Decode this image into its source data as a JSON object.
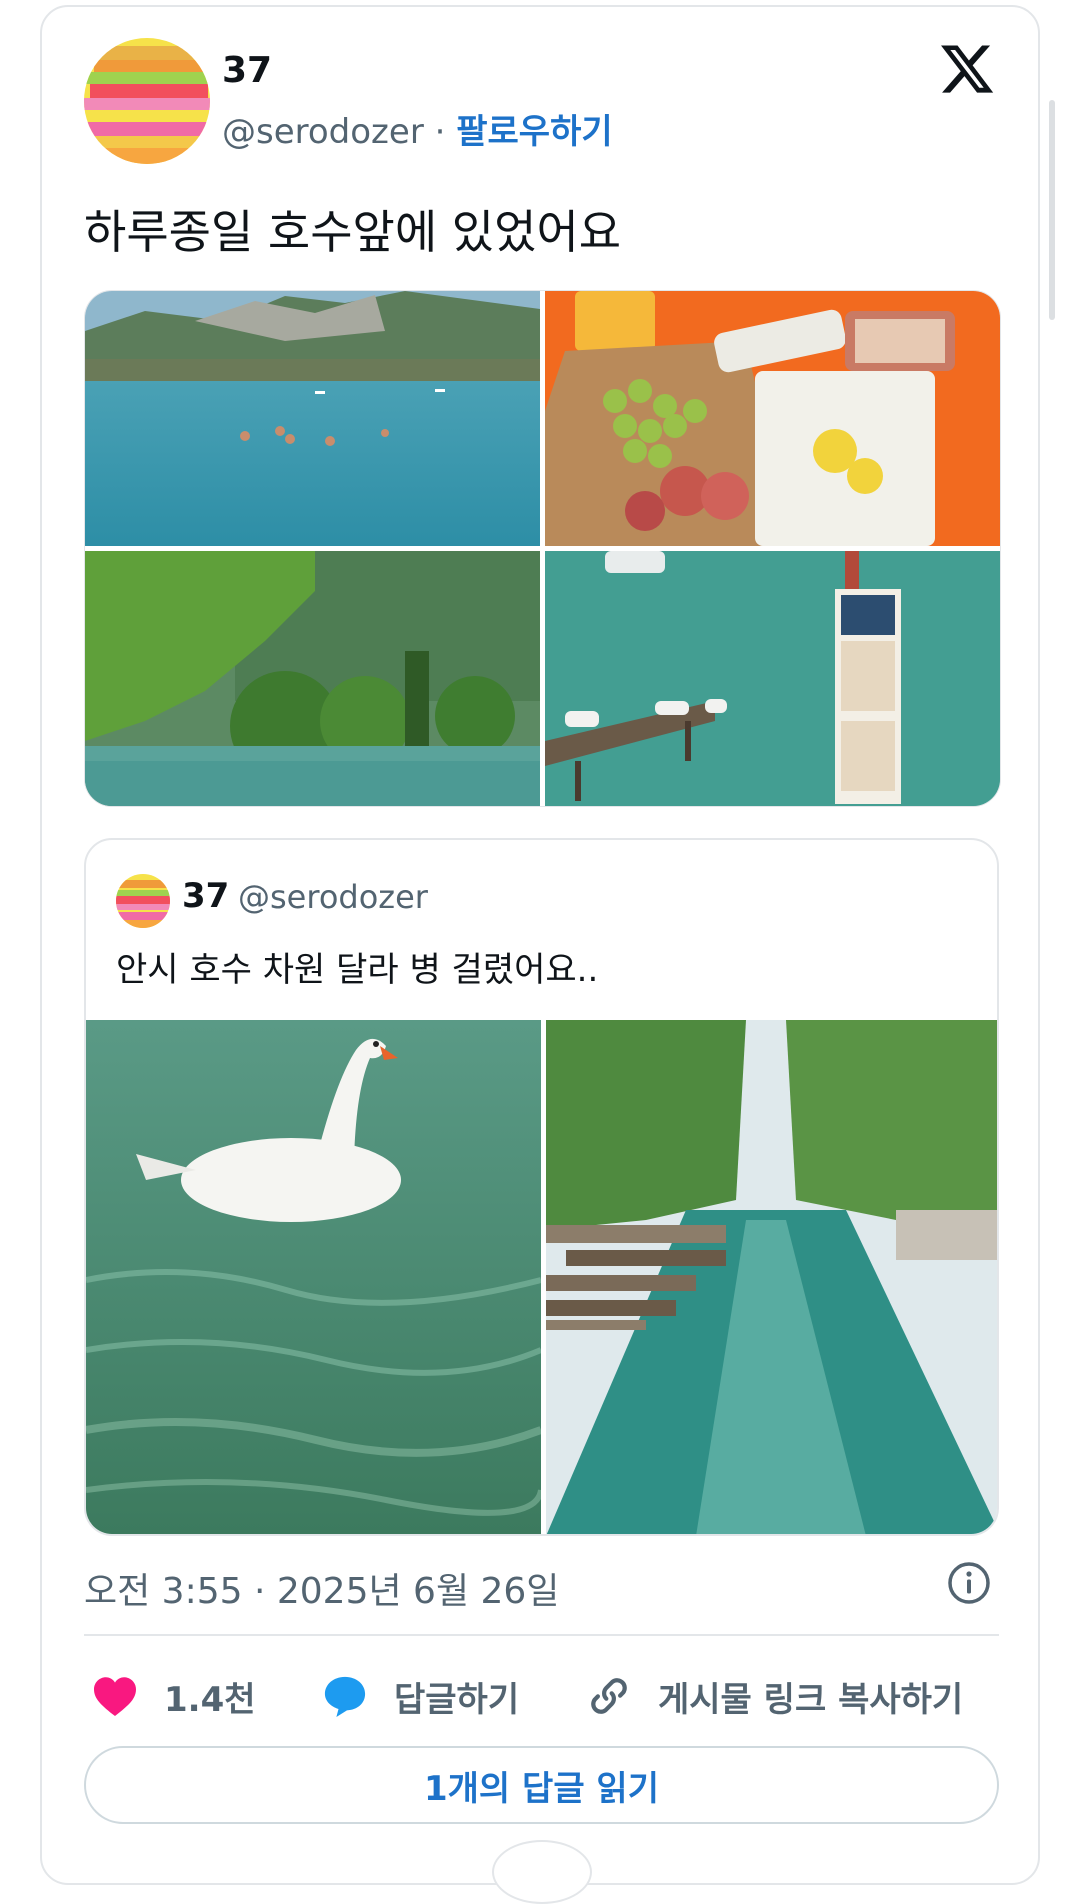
{
  "author": {
    "name": "37",
    "handle": "@serodozer",
    "separator": "·",
    "follow_label": "팔로우하기"
  },
  "tweet": {
    "text": "하루종일 호수앞에 있었어요",
    "images": [
      "lake-swimmers-photo",
      "picnic-food-photo",
      "lakeside-trees-photo",
      "pier-sign-photo"
    ]
  },
  "quote": {
    "name": "37",
    "handle": "@serodozer",
    "text": "안시 호수 차원 달라 병 걸렸어요..",
    "images": [
      "swan-photo",
      "canal-photo"
    ]
  },
  "meta": {
    "timestamp": "오전 3:55 · 2025년 6월 26일"
  },
  "actions": {
    "like_count": "1.4천",
    "reply_label": "답글하기",
    "copy_link_label": "게시물 링크 복사하기"
  },
  "read_replies_label": "1개의 답글 읽기",
  "colors": {
    "accent": "#1d72c9",
    "like": "#f91880",
    "reply": "#1d9bf0",
    "muted": "#536471"
  }
}
